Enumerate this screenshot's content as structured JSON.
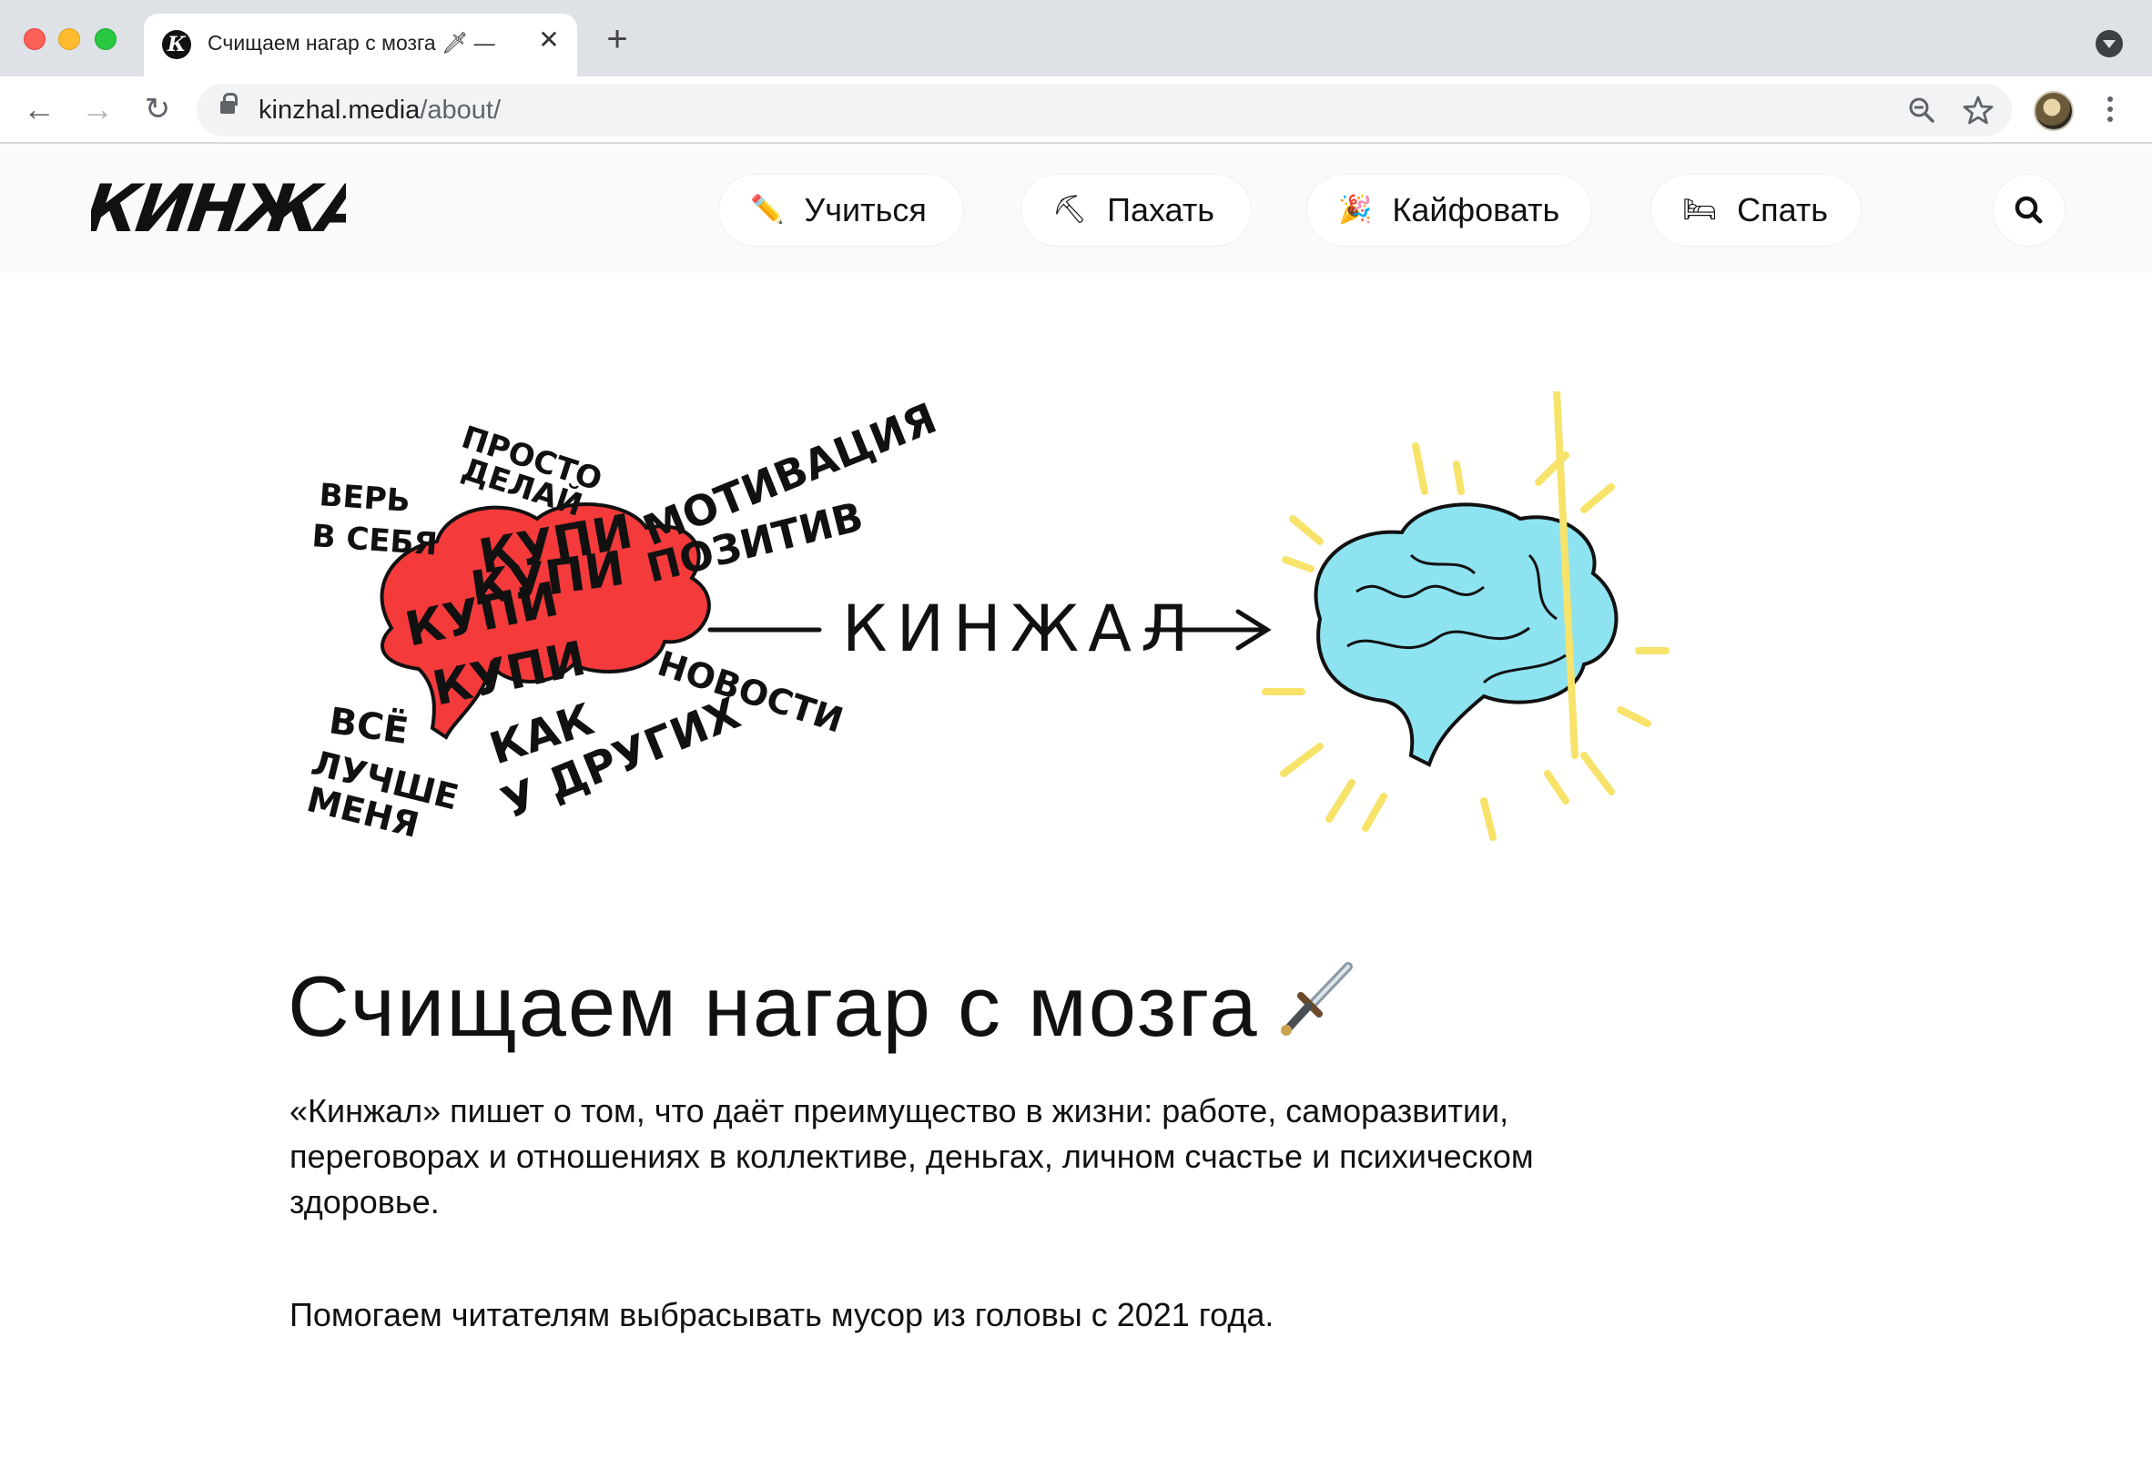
{
  "browser": {
    "tab": {
      "favicon_letter": "К",
      "title": "Счищаем нагар с мозга 🗡 —",
      "close_glyph": "✕"
    },
    "new_tab_glyph": "+",
    "nav": {
      "back": "←",
      "forward": "→",
      "reload": "↻"
    },
    "url": {
      "host": "kinzhal.media",
      "path": "/about/"
    },
    "icons": [
      "zoom-out-icon",
      "bookmark-star-icon",
      "profile-avatar",
      "more-menu-icon"
    ]
  },
  "site": {
    "logo_text": "КИНЖАЛ",
    "menu": [
      {
        "emoji": "✏️",
        "label": "Учиться"
      },
      {
        "emoji": "⛏",
        "label": "Пахать"
      },
      {
        "emoji": "🎉",
        "label": "Кайфовать"
      },
      {
        "emoji": "🛏",
        "label": "Спать"
      }
    ]
  },
  "illustration": {
    "left_words": [
      "ПРОСТО",
      "ДЕЛАЙ",
      "МОТИВАЦИЯ",
      "ВЕРЬ",
      "В СЕБЯ",
      "КУПИ",
      "КУПИ",
      "КУПИ",
      "КУПИ",
      "ПОЗИТИВ",
      "НОВОСТИ",
      "ВСЁ",
      "ЛУЧШЕ",
      "МЕНЯ",
      "КАК",
      "У ДРУГИХ"
    ],
    "arrow_label": "КИНЖАЛ",
    "colors": {
      "red_brain": "#f53a3c",
      "blue_brain": "#8de3f0",
      "rays": "#f7e36a",
      "ink": "#111111"
    }
  },
  "article": {
    "title": "Счищаем нагар с мозга",
    "title_icon": "dagger-icon",
    "lead": "«Кинжал» пишет о том, что даёт преимущество в жизни: работе, саморазвитии, переговорах и отношениях в коллективе, деньгах, личном счастье и психическом здоровье.",
    "note": "Помогаем читателям выбрасывать мусор из головы с 2021 года."
  }
}
